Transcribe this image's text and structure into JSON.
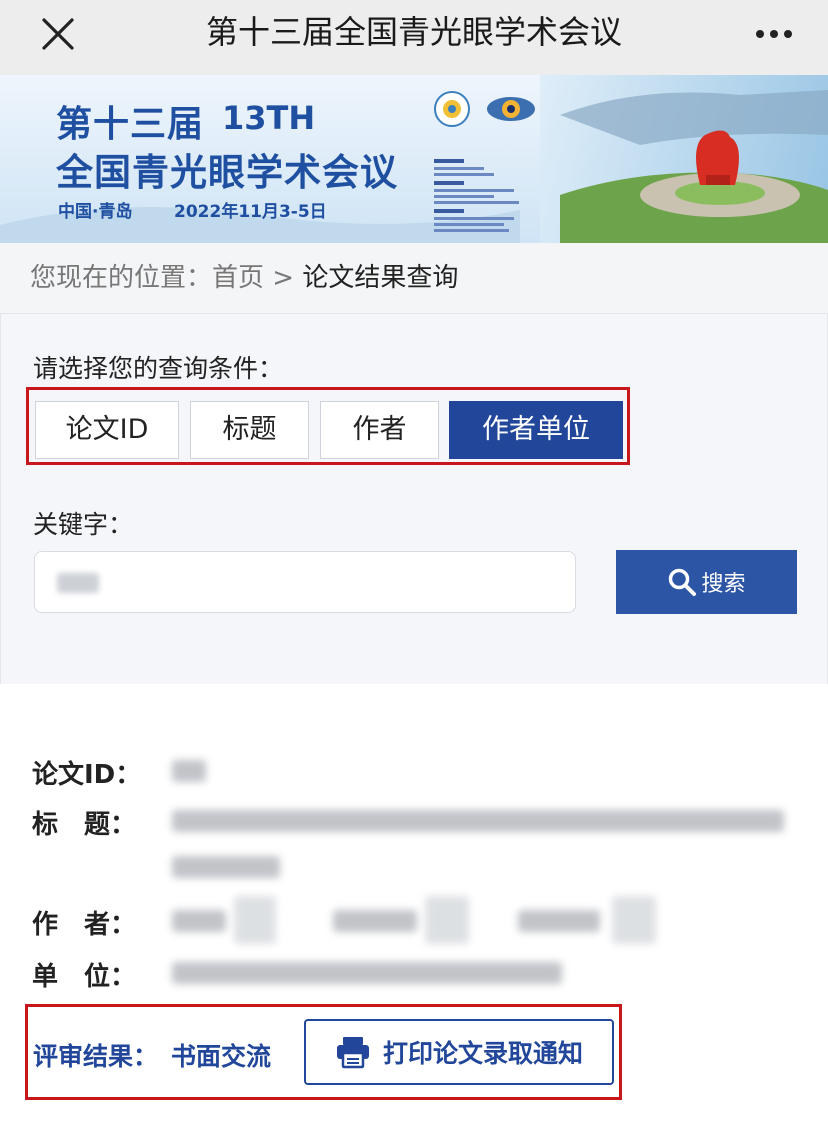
{
  "window": {
    "title": "第十三届全国青光眼学术会议",
    "close_icon": "close-icon",
    "more_icon": "more-icon"
  },
  "banner": {
    "title_line1": "第十三届",
    "number": "13TH",
    "title_line2": "全国青光眼学术会议",
    "location": "中国·青岛",
    "date": "2022年11月3-5日",
    "colors": {
      "text": "#1f4fa0",
      "sky": "#dbeafa",
      "sea": "#8fc0e0"
    }
  },
  "breadcrumb": {
    "prefix": "您现在的位置：",
    "home": "首页",
    "separator": ">",
    "current": "论文结果查询"
  },
  "search": {
    "condition_label": "请选择您的查询条件：",
    "filters": [
      {
        "label": "论文ID",
        "active": false
      },
      {
        "label": "标题",
        "active": false
      },
      {
        "label": "作者",
        "active": false
      },
      {
        "label": "作者单位",
        "active": true
      }
    ],
    "keyword_label": "关键字：",
    "keyword_value": "",
    "search_button": "搜索",
    "colors": {
      "primary": "#22479a",
      "button": "#2c55a6"
    }
  },
  "result": {
    "id_label": "论文ID：",
    "title_label": "标　题：",
    "authors_label": "作　者：",
    "affiliation_label": "单　位：",
    "review_label": "评审结果：",
    "review_value": "书面交流",
    "print_button": "打印论文录取通知",
    "highlight_color": "#c8161d"
  }
}
